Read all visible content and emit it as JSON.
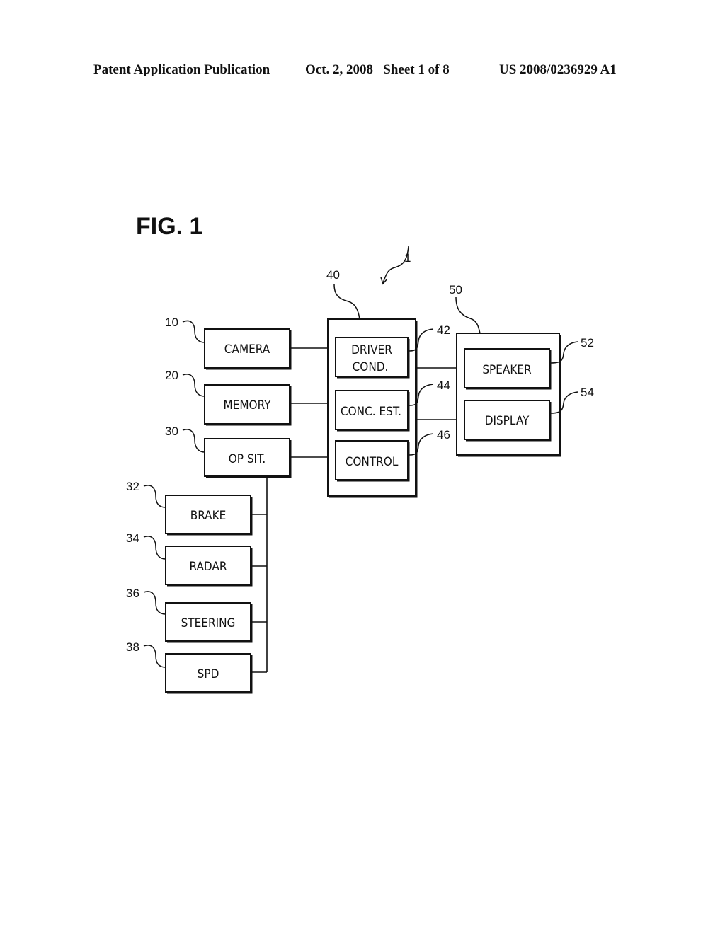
{
  "header": {
    "left": "Patent Application Publication",
    "middle": "Oct. 2, 2008   Sheet 1 of 8",
    "right": "US 2008/0236929 A1"
  },
  "figure": {
    "title": "FIG. 1",
    "system_ref": "1",
    "blocks": {
      "camera": {
        "ref": "10",
        "label": "CAMERA"
      },
      "memory": {
        "ref": "20",
        "label": "MEMORY"
      },
      "op_sit": {
        "ref": "30",
        "label": "OP SIT."
      },
      "brake": {
        "ref": "32",
        "label": "BRAKE"
      },
      "radar": {
        "ref": "34",
        "label": "RADAR"
      },
      "steering": {
        "ref": "36",
        "label": "STEERING"
      },
      "spd": {
        "ref": "38",
        "label": "SPD"
      },
      "controller": {
        "ref": "40"
      },
      "driver_cond": {
        "ref": "42",
        "label_line1": "DRIVER",
        "label_line2": "COND."
      },
      "conc_est": {
        "ref": "44",
        "label": "CONC. EST."
      },
      "control": {
        "ref": "46",
        "label": "CONTROL"
      },
      "output": {
        "ref": "50"
      },
      "speaker": {
        "ref": "52",
        "label": "SPEAKER"
      },
      "display": {
        "ref": "54",
        "label": "DISPLAY"
      }
    }
  }
}
